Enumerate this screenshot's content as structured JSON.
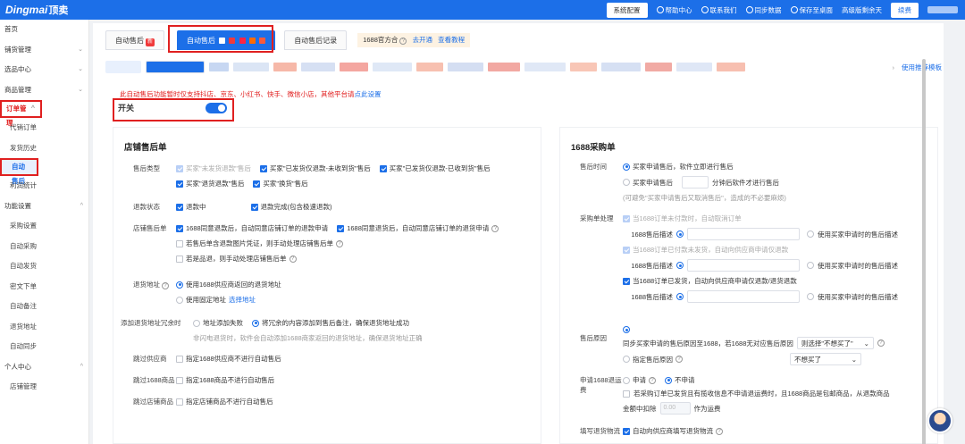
{
  "topbar": {
    "logo_text": "Dingmai",
    "logo_cn": "顶卖",
    "system_config": "系统配置",
    "help": "帮助中心",
    "contact": "联系我们",
    "sync": "同步数据",
    "save_desktop": "保存至桌面",
    "advanced_expire": "高级版剩余天",
    "renew": "续费"
  },
  "sidebar": {
    "items": [
      {
        "label": "首页",
        "type": "top"
      },
      {
        "label": "铺货管理",
        "type": "top",
        "chev": "⌄"
      },
      {
        "label": "选品中心",
        "type": "top",
        "chev": "⌄"
      },
      {
        "label": "商品管理",
        "type": "top",
        "chev": "⌄"
      },
      {
        "label": "订单管理",
        "type": "group",
        "chev": "^"
      },
      {
        "label": "代销订单",
        "type": "sub"
      },
      {
        "label": "发货历史",
        "type": "sub"
      },
      {
        "label": "自动售后",
        "type": "active"
      },
      {
        "label": "利润统计",
        "type": "sub"
      },
      {
        "label": "功能设置",
        "type": "top",
        "chev": "^"
      },
      {
        "label": "采购设置",
        "type": "sub"
      },
      {
        "label": "自动采购",
        "type": "sub"
      },
      {
        "label": "自动发货",
        "type": "sub"
      },
      {
        "label": "密文下单",
        "type": "sub"
      },
      {
        "label": "自动备注",
        "type": "sub"
      },
      {
        "label": "退货地址",
        "type": "sub"
      },
      {
        "label": "自动同步",
        "type": "sub"
      },
      {
        "label": "个人中心",
        "type": "top",
        "chev": "^"
      },
      {
        "label": "店铺管理",
        "type": "sub"
      }
    ]
  },
  "tabs": {
    "tab1": "自动售后",
    "tab1_badge": "新",
    "tab2": "自动售后",
    "tab3": "自动售后记录",
    "notice_prefix": "1688官方合",
    "notice_open": "去开通",
    "notice_tutorial": "查看教程"
  },
  "shops": {
    "use_template": "使用推荐模板"
  },
  "warning": {
    "text": "此自动售后功能暂时仅支持抖店、京东、小红书、快手、微信小店，其他平台请",
    "link": "点此设置"
  },
  "switch": {
    "label": "开关"
  },
  "left": {
    "title": "店铺售后单",
    "type_label": "售后类型",
    "type_opts": [
      "买家\"未发货退款\"售后",
      "买家\"已发货仅退款-未收到货\"售后",
      "买家\"已发货仅退款-已收到货\"售后",
      "买家\"退货退款\"售后",
      "买家\"换货\"售后"
    ],
    "refund_label": "退款状态",
    "refund_opts": [
      "退款中",
      "退款完成(包含极速退款)"
    ],
    "shop_label": "店铺售后单",
    "shop_opt1": "1688同意退款后，自动同意店铺订单的退款申请",
    "shop_opt2": "1688同意退货后，自动同意店铺订单的退货申请",
    "shop_opt3": "若售后单含退款图片凭证，则手动处理店铺售后单",
    "shop_opt4": "若是品退，则手动处理店铺售后单",
    "addr_label": "退货地址",
    "addr_opt1": "使用1688供应商返回的退货地址",
    "addr_opt2": "使用固定地址",
    "addr_link": "选择地址",
    "redundant_label": "添加退货地址冗余时",
    "redundant_opt1": "地址添加失败",
    "redundant_opt2": "将冗余的内容添加到售后备注，确保退货地址成功",
    "redundant_hint": "非闪电退货时，软件会自动添加1688商家返回的退货地址，确保退货地址正确",
    "skip_supplier_label": "跳过供应商",
    "skip_supplier_opt": "指定1688供应商不进行自动售后",
    "skip_1688_label": "跳过1688商品",
    "skip_1688_opt": "指定1688商品不进行自动售后",
    "skip_shop_label": "跳过店铺商品",
    "skip_shop_opt": "指定店铺商品不进行自动售后"
  },
  "right": {
    "title": "1688采购单",
    "time_label": "售后时间",
    "time_opt1": "买家申请售后，软件立即进行售后",
    "time_opt2_a": "买家申请售后",
    "time_opt2_b": "分钟后软件才进行售后",
    "time_hint": "(可避免\"买家申请售后又取消售后\"，造成的不必要麻烦)",
    "proc_label": "采购单处理",
    "proc_opt1": "当1688订单未付款时，自动取消订单",
    "desc_label": "1688售后描述",
    "use_buyer_desc": "使用买家申请时的售后描述",
    "proc_opt2": "当1688订单已付款未发货，自动向供应商申请仅退款",
    "proc_opt3": "当1688订单已发货，自动向供应商申请仅退款/退货退款",
    "reason_label": "售后原因",
    "reason_sync": "同步买家申请的售后原因至1688，若1688无对应售后原因",
    "reason_select": "则选择\"不想买了\"",
    "reason_specify": "指定售后原因",
    "reason_default": "不想买了",
    "fee_label": "申请1688退运费",
    "fee_yes": "申请",
    "fee_no": "不申请",
    "fee_hint_a": "若采购订单已发货且有揽收信息不申请退运费时，且1688商品是包邮商品，从退款商品",
    "fee_hint_b": "金额中扣除",
    "fee_value": "0.00",
    "fee_hint_c": "作为运费",
    "fill_label": "填写退货物流",
    "fill_opt": "自动向供应商填写退货物流"
  }
}
